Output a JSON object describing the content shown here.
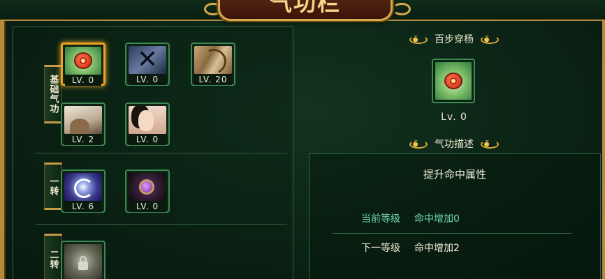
{
  "window": {
    "title": "气功栏"
  },
  "categories": [
    {
      "label": "基础气功"
    },
    {
      "label": "一转"
    },
    {
      "label": "二转"
    }
  ],
  "skills": [
    {
      "level": "LV. 0",
      "icon": "apple-target-icon",
      "selected": true
    },
    {
      "level": "LV. 0",
      "icon": "black-x-icon"
    },
    {
      "level": "LV. 20",
      "icon": "claw-icon"
    },
    {
      "level": "LV. 2",
      "icon": "hand-icon"
    },
    {
      "level": "LV. 0",
      "icon": "warrior-face-icon"
    },
    {
      "level": "LV. 6",
      "icon": "blue-spiral-icon"
    },
    {
      "level": "LV. 0",
      "icon": "purple-orb-icon"
    },
    {
      "level": "",
      "icon": "lock-icon",
      "locked": true
    }
  ],
  "detail": {
    "name": "百步穿杨",
    "level": "Lv. 0",
    "description_title": "气功描述",
    "description": "提升命中属性",
    "current_label": "当前等级",
    "current_value": "命中增加0",
    "next_label": "下一等级",
    "next_value": "命中增加2"
  },
  "colors": {
    "gold": "#d7a94a",
    "selected_border": "#f0a020",
    "current_text": "#6fd6b0"
  }
}
